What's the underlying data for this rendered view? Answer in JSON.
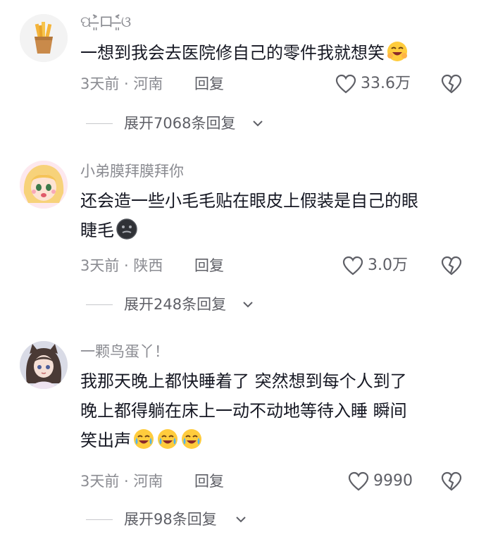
{
  "comments": [
    {
      "username": "ପ˃̶͈̀ロ˂̶͈́ଓ",
      "avatar": "fries-icon",
      "text_lines": [
        "一想到我会去医院修自己的零件我就想笑"
      ],
      "emoji": "grinning-hug-emoji",
      "time_location": "3天前 · 河南",
      "reply_label": "回复",
      "likes": "33.6万",
      "expand_label": "展开7068条回复"
    },
    {
      "username": "小弟膜拜膜拜你",
      "avatar": "anime-girl-avatar",
      "text_lines": [
        "还会造一些小毛毛贴在眼皮上假装是自己的眼",
        "睫毛"
      ],
      "emoji": "dark-face-emoji",
      "time_location": "3天前 · 陕西",
      "reply_label": "回复",
      "likes": "3.0万",
      "expand_label": "展开248条回复"
    },
    {
      "username": "一颗鸟蛋丫！",
      "avatar": "girl-cat-ears-avatar",
      "text_lines": [
        "我那天晚上都快睡着了 突然想到每个人到了",
        "晚上都得躺在床上一动不动地等待入睡 瞬间",
        "笑出声"
      ],
      "emoji": "crying-laughing-emoji",
      "time_location": "3天前 · 河南",
      "reply_label": "回复",
      "likes": "9990",
      "expand_label": "展开98条回复"
    }
  ],
  "colors": {
    "text": "#161823",
    "secondary": "#8a8b91",
    "action": "#5e5f66"
  }
}
